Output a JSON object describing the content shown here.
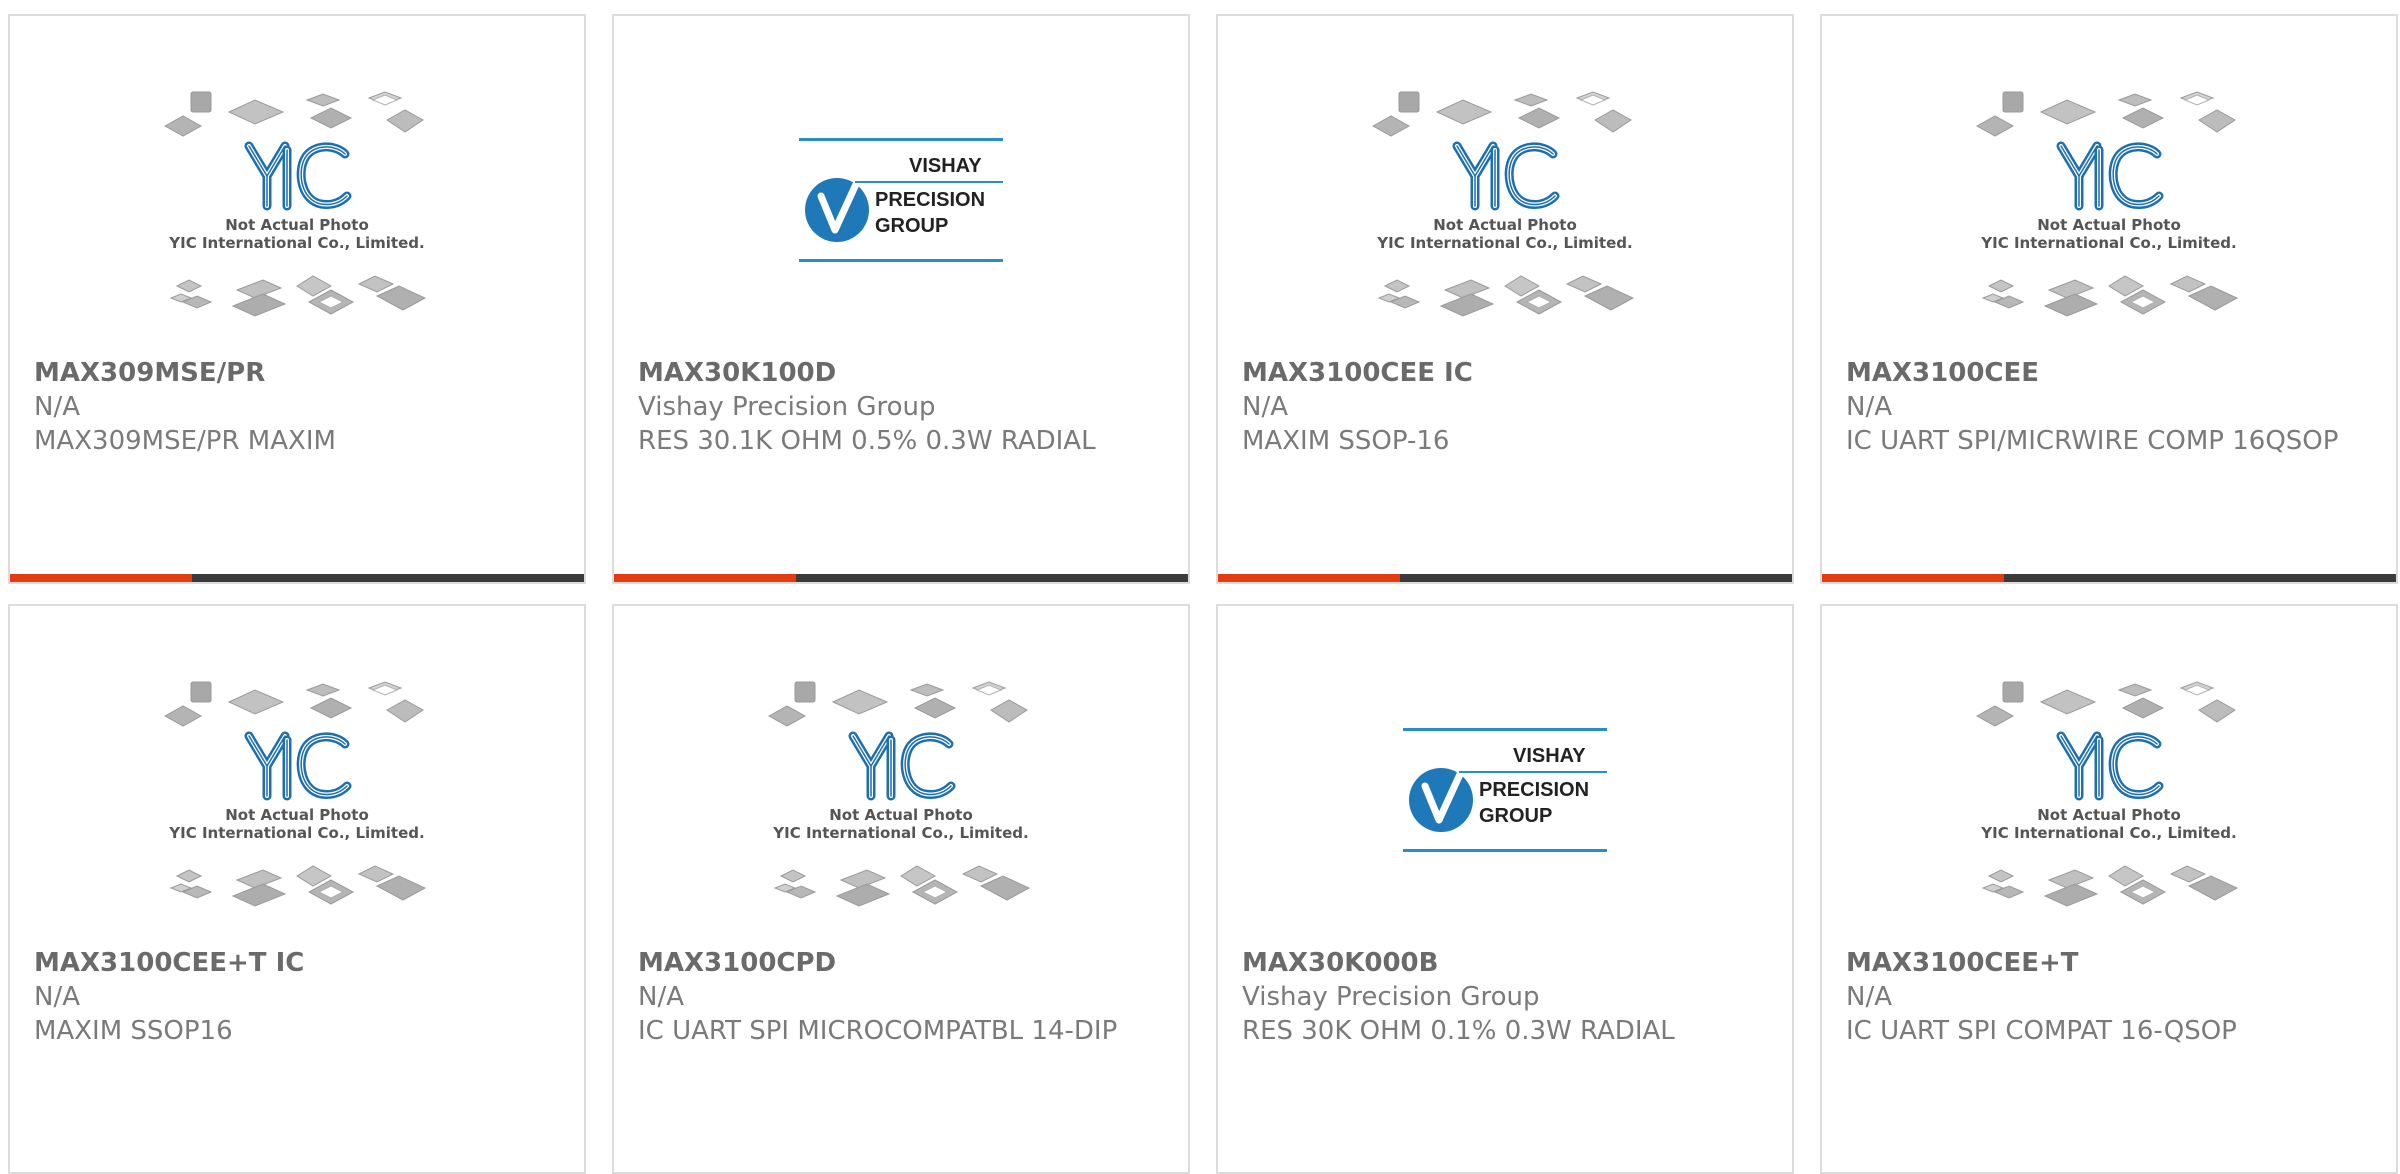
{
  "products": [
    {
      "part_number": "MAX309MSE/PR",
      "manufacturer": "N/A",
      "description": "MAX309MSE/PR MAXIM",
      "image": "yic-placeholder",
      "placeholder_caption_1": "Not Actual Photo",
      "placeholder_caption_2": "YIC International Co., Limited.",
      "highlight": true
    },
    {
      "part_number": "MAX30K100D",
      "manufacturer": "Vishay Precision Group",
      "description": "RES 30.1K OHM 0.5% 0.3W RADIAL",
      "image": "vishay-logo",
      "logo_text_1": "VISHAY",
      "logo_text_2": "PRECISION",
      "logo_text_3": "GROUP",
      "highlight": true
    },
    {
      "part_number": "MAX3100CEE IC",
      "manufacturer": "N/A",
      "description": "MAXIM SSOP-16",
      "image": "yic-placeholder",
      "placeholder_caption_1": "Not Actual Photo",
      "placeholder_caption_2": "YIC International Co., Limited.",
      "highlight": true
    },
    {
      "part_number": "MAX3100CEE",
      "manufacturer": "N/A",
      "description": "IC UART SPI/MICRWIRE COMP 16QSOP",
      "image": "yic-placeholder",
      "placeholder_caption_1": "Not Actual Photo",
      "placeholder_caption_2": "YIC International Co., Limited.",
      "highlight": true
    },
    {
      "part_number": "MAX3100CEE+T IC",
      "manufacturer": "N/A",
      "description": "MAXIM SSOP16",
      "image": "yic-placeholder",
      "placeholder_caption_1": "Not Actual Photo",
      "placeholder_caption_2": "YIC International Co., Limited.",
      "highlight": false
    },
    {
      "part_number": "MAX3100CPD",
      "manufacturer": "N/A",
      "description": "IC UART SPI MICROCOMPATBL 14-DIP",
      "image": "yic-placeholder",
      "placeholder_caption_1": "Not Actual Photo",
      "placeholder_caption_2": "YIC International Co., Limited.",
      "highlight": false
    },
    {
      "part_number": "MAX30K000B",
      "manufacturer": "Vishay Precision Group",
      "description": "RES 30K OHM 0.1% 0.3W RADIAL",
      "image": "vishay-logo",
      "logo_text_1": "VISHAY",
      "logo_text_2": "PRECISION",
      "logo_text_3": "GROUP",
      "highlight": false
    },
    {
      "part_number": "MAX3100CEE+T",
      "manufacturer": "N/A",
      "description": "IC UART SPI COMPAT 16-QSOP",
      "image": "yic-placeholder",
      "placeholder_caption_1": "Not Actual Photo",
      "placeholder_caption_2": "YIC International Co., Limited.",
      "highlight": false
    }
  ],
  "colors": {
    "accent": "#e23c10",
    "bar": "#3b3b3b",
    "border": "#dcdcdc",
    "text": "#707070",
    "yic_blue": "#1d6fb0",
    "vishay_blue": "#2a8dc7"
  }
}
